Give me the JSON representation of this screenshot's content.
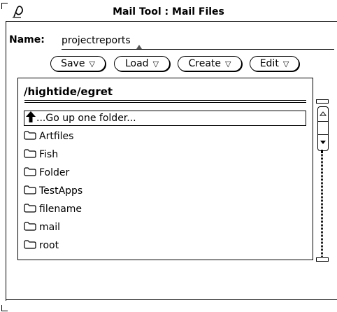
{
  "window": {
    "title": "Mail Tool : Mail Files"
  },
  "name_field": {
    "label": "Name:",
    "value": "projectreports"
  },
  "buttons": [
    {
      "label": "Save"
    },
    {
      "label": "Load"
    },
    {
      "label": "Create"
    },
    {
      "label": "Edit"
    }
  ],
  "folder_list": {
    "path": "/hightide/egret",
    "go_up": "...Go up one folder...",
    "items": [
      {
        "label": "Artfiles"
      },
      {
        "label": "Fish"
      },
      {
        "label": "Folder"
      },
      {
        "label": "TestApps"
      },
      {
        "label": "filename"
      },
      {
        "label": "mail"
      },
      {
        "label": "root"
      }
    ]
  },
  "icons": {
    "title_menu": "window-menu-glyph-icon",
    "menu_arrow": "menu-triangle-icon",
    "go_up": "up-arrow-icon",
    "folder": "folder-icon",
    "caret": "text-caret-icon"
  },
  "colors": {
    "background": "#ffffff",
    "foreground": "#000000"
  }
}
